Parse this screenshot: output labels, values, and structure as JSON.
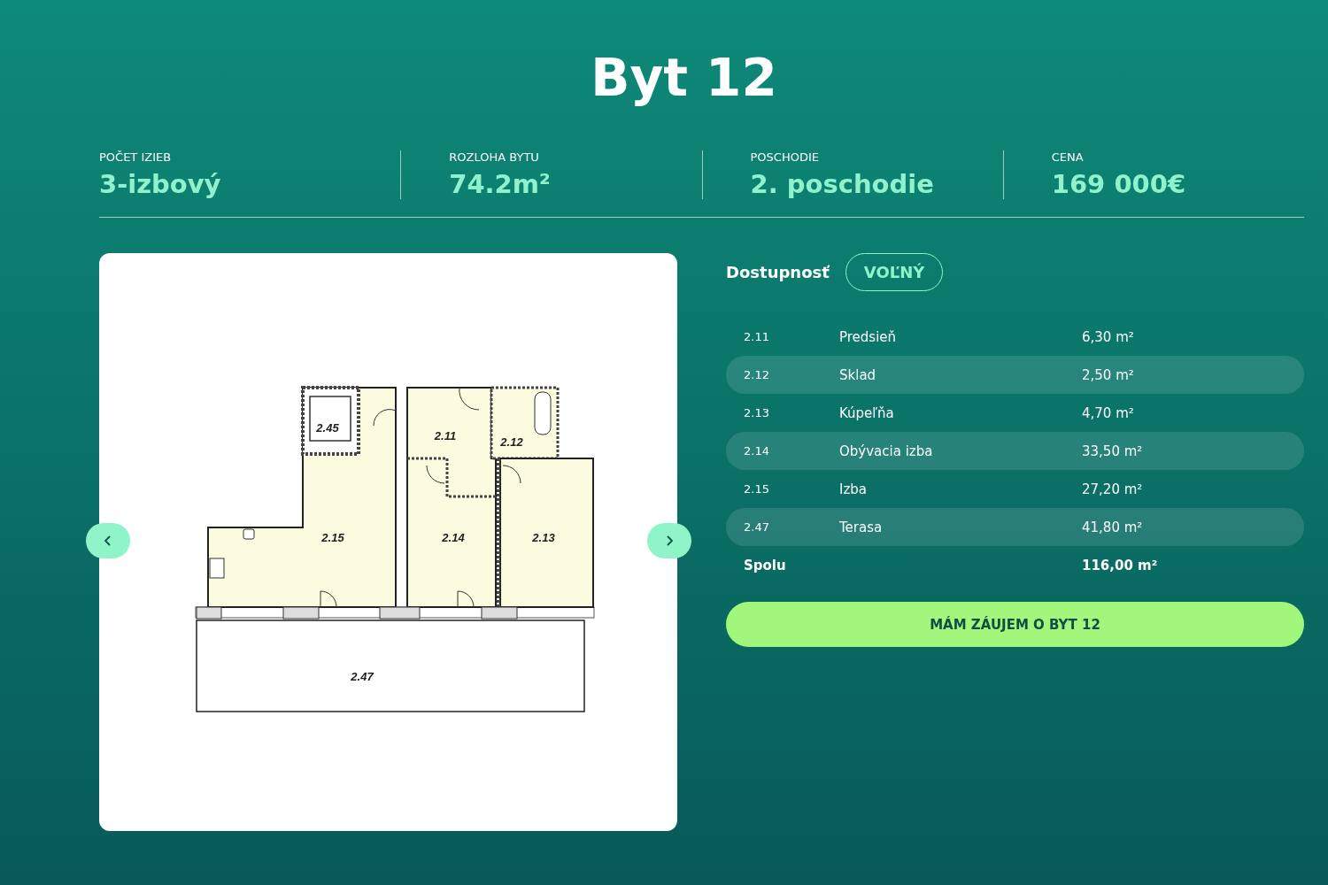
{
  "title": "Byt 12",
  "stats": [
    {
      "label": "POČET IZIEB",
      "value": "3-izbový"
    },
    {
      "label": "ROZLOHA BYTU",
      "value": "74.2m²"
    },
    {
      "label": "POSCHODIE",
      "value": "2. poschodie"
    },
    {
      "label": "CENA",
      "value": "169 000€"
    }
  ],
  "floor_plan": {
    "room_labels": [
      "2.45",
      "2.15",
      "2.11",
      "2.12",
      "2.14",
      "2.13",
      "2.47"
    ]
  },
  "availability": {
    "label": "Dostupnosť",
    "status": "VOĽNÝ"
  },
  "rooms": [
    {
      "code": "2.11",
      "name": "Predsieň",
      "area": "6,30 m²"
    },
    {
      "code": "2.12",
      "name": "Sklad",
      "area": "2,50 m²"
    },
    {
      "code": "2.13",
      "name": "Kúpeľňa",
      "area": "4,70 m²"
    },
    {
      "code": "2.14",
      "name": "Obývacia izba",
      "area": "33,50 m²"
    },
    {
      "code": "2.15",
      "name": "Izba",
      "area": "27,20 m²"
    },
    {
      "code": "2.47",
      "name": "Terasa",
      "area": "41,80 m²"
    }
  ],
  "total": {
    "label": "Spolu",
    "area": "116,00 m²"
  },
  "cta_button": "MÁM ZÁUJEM O BYT 12"
}
